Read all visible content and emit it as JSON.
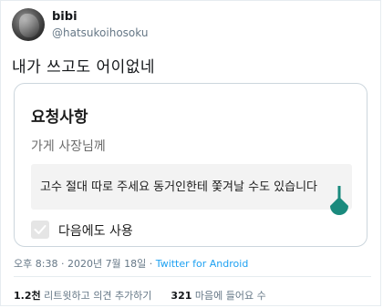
{
  "author": {
    "display_name": "bibi",
    "handle": "@hatsukoihosoku"
  },
  "tweet": {
    "text": "내가 쓰고도 어이없네"
  },
  "card": {
    "title": "요청사항",
    "subtitle": "가게 사장님께",
    "request_text": "고수 절대 따로 주세요 동거인한테 쫓겨날 수도 있습니다",
    "checkbox_label": "다음에도 사용",
    "checkbox_checked": true
  },
  "meta": {
    "time": "오후 8:38",
    "separator": "·",
    "date": "2020년 7월 18일",
    "source": "Twitter for Android"
  },
  "stats": {
    "retweets_count": "1.2천",
    "retweets_label": "리트윗하고 의견 추가하기",
    "likes_count": "321",
    "likes_label": "마음에 들어요 수"
  },
  "colors": {
    "link": "#1da1f2",
    "handle_teal": "#1a8a7d"
  }
}
